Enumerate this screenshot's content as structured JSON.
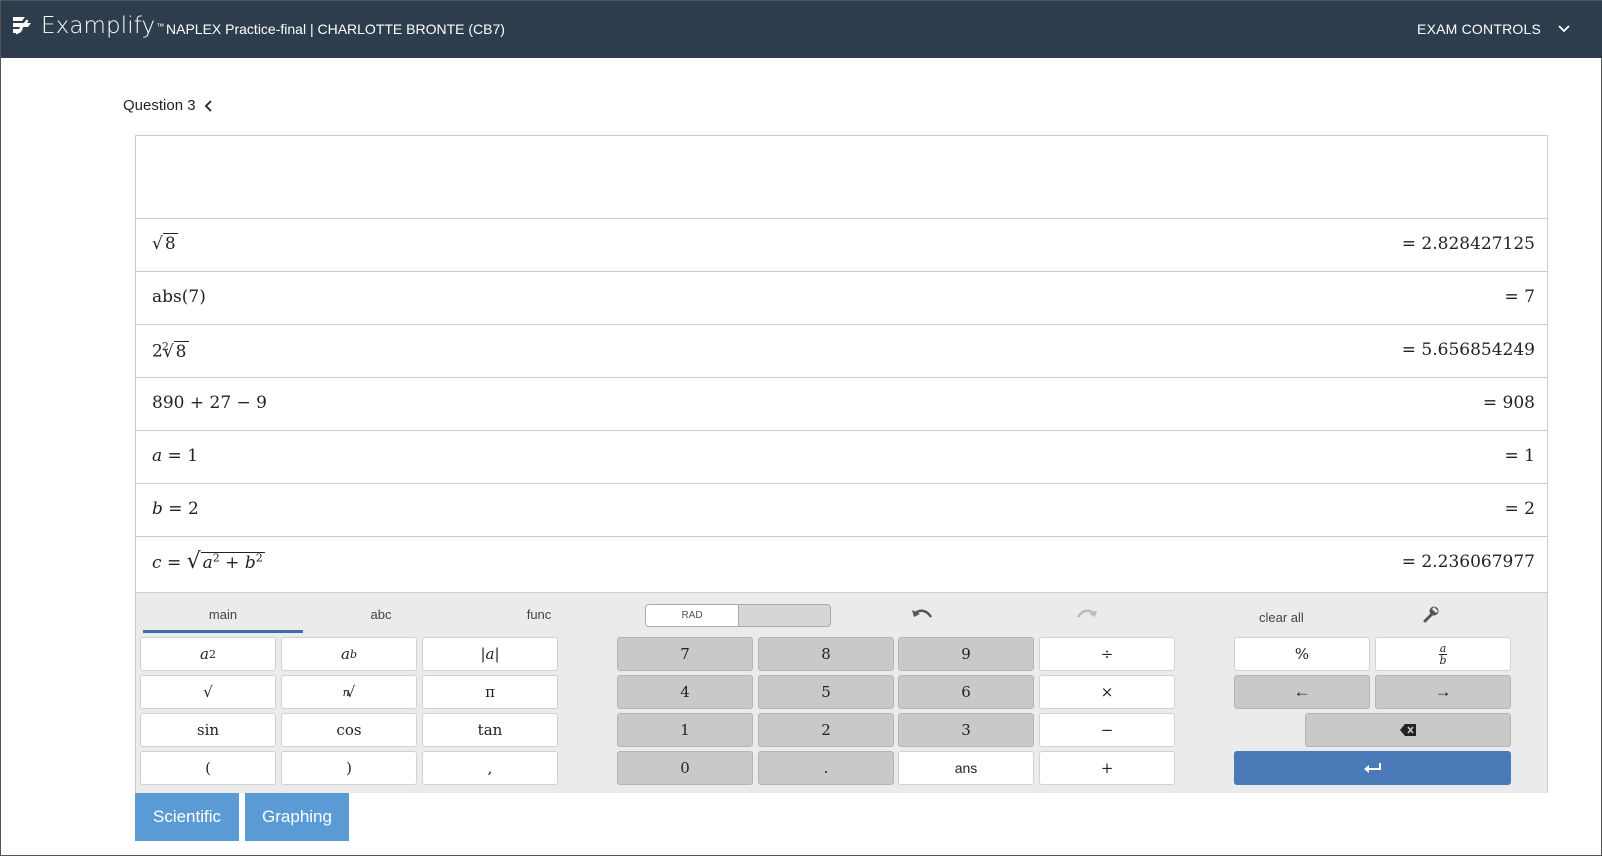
{
  "header": {
    "app_name": "Examplify",
    "tm": "™",
    "exam_title": "NAPLEX Practice-final | CHARLOTTE BRONTE (CB7)",
    "controls_label": "EXAM CONTROLS"
  },
  "question": {
    "label": "Question 3"
  },
  "expressions": [
    {
      "radicand": "8",
      "result": "= 2.828427125"
    },
    {
      "text": "abs(7)",
      "result": "= 7"
    },
    {
      "coef": "2",
      "index": "2",
      "radicand": "8",
      "result": "= 5.656854249"
    },
    {
      "text": "890 + 27 − 9",
      "result": "= 908"
    },
    {
      "var": "a",
      "rhs": "= 1",
      "result": "= 1"
    },
    {
      "var": "b",
      "rhs": "= 2",
      "result": "= 2"
    },
    {
      "var": "c",
      "eq": "=",
      "a": "a",
      "b": "b",
      "exp": "2",
      "plus": "+",
      "result": "= 2.236067977"
    }
  ],
  "keypad": {
    "tabs": [
      "main",
      "abc",
      "func"
    ],
    "angle_mode": "RAD",
    "clear_all": "clear all",
    "functions": {
      "a_sq_base": "a",
      "a_sq_exp": "2",
      "a_b_base": "a",
      "a_b_exp": "b",
      "abs": "|a|",
      "sqrt": "√",
      "nroot_index": "n",
      "nroot": "√",
      "pi": "π",
      "sin": "sin",
      "cos": "cos",
      "tan": "tan",
      "lparen": "(",
      "rparen": ")",
      "comma": ","
    },
    "digits": {
      "d7": "7",
      "d8": "8",
      "d9": "9",
      "d4": "4",
      "d5": "5",
      "d6": "6",
      "d1": "1",
      "d2": "2",
      "d3": "3",
      "d0": "0",
      "dot": "."
    },
    "ops": {
      "divide": "÷",
      "times": "×",
      "minus": "−",
      "plus": "+",
      "ans": "ans"
    },
    "extra": {
      "percent": "%",
      "frac_num": "a",
      "frac_den": "b",
      "left": "←",
      "right": "→"
    }
  },
  "modes": {
    "scientific": "Scientific",
    "graphing": "Graphing"
  },
  "colors": {
    "header_bg": "#2e3d4e",
    "accent": "#4a7ab8",
    "mode_btn": "#5b9bd5"
  }
}
